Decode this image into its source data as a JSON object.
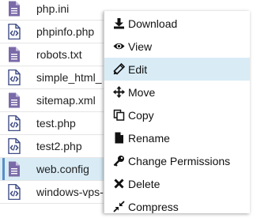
{
  "files": [
    {
      "name": "php.ini",
      "icon": "text-file-icon"
    },
    {
      "name": "phpinfo.php",
      "icon": "code-file-icon"
    },
    {
      "name": "robots.txt",
      "icon": "text-file-icon"
    },
    {
      "name": "simple_html_",
      "icon": "code-file-icon"
    },
    {
      "name": "sitemap.xml",
      "icon": "text-file-icon"
    },
    {
      "name": "test.php",
      "icon": "code-file-icon"
    },
    {
      "name": "test2.php",
      "icon": "code-file-icon"
    },
    {
      "name": "web.config",
      "icon": "text-file-icon",
      "selected": true
    },
    {
      "name": "windows-vps-",
      "icon": "code-file-icon"
    }
  ],
  "context_menu": {
    "items": [
      {
        "label": "Download",
        "icon": "download-icon"
      },
      {
        "label": "View",
        "icon": "eye-icon"
      },
      {
        "label": "Edit",
        "icon": "pencil-icon",
        "hovered": true
      },
      {
        "label": "Move",
        "icon": "move-arrows-icon"
      },
      {
        "label": "Copy",
        "icon": "copy-icon"
      },
      {
        "label": "Rename",
        "icon": "file-icon"
      },
      {
        "label": "Change Permissions",
        "icon": "key-icon"
      },
      {
        "label": "Delete",
        "icon": "x-icon"
      },
      {
        "label": "Compress",
        "icon": "compress-icon"
      }
    ]
  },
  "colors": {
    "text_file_icon": "#7b6aa8",
    "code_file_icon": "#3f4d86",
    "selection": "#d9ecf6",
    "selection_bar": "#5a8ec6"
  }
}
